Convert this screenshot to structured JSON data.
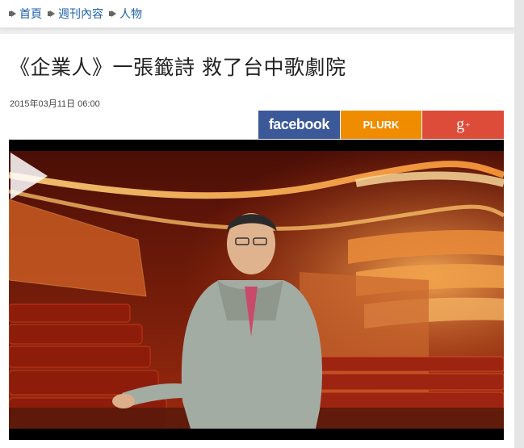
{
  "breadcrumb": [
    {
      "label": "首頁"
    },
    {
      "label": "週刊內容"
    },
    {
      "label": "人物"
    }
  ],
  "article": {
    "title": "《企業人》一張籤詩 救了台中歌劇院",
    "published": "2015年03月11日 06:00"
  },
  "share": {
    "facebook_label": "facebook",
    "plurk_label": "PLURK",
    "gplus_label": "g",
    "gplus_sup": "+"
  },
  "colors": {
    "link": "#1d5fa8",
    "facebook": "#3b5998",
    "plurk": "#f08c00",
    "gplus": "#dd4b39"
  },
  "video": {
    "play_icon": "play-icon"
  }
}
